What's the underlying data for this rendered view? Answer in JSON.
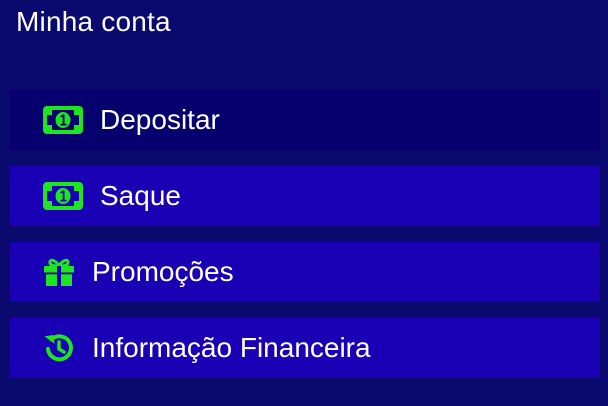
{
  "header": {
    "title": "Minha conta"
  },
  "colors": {
    "background": "#0a0a6e",
    "item_background": "#1a00b4",
    "item_active_background": "#05006e",
    "icon_accent": "#1ee61e",
    "text": "#ffffff"
  },
  "menu": {
    "items": [
      {
        "label": "Depositar",
        "icon": "money-bill-icon",
        "active": true
      },
      {
        "label": "Saque",
        "icon": "money-bill-icon",
        "active": false
      },
      {
        "label": "Promoções",
        "icon": "gift-icon",
        "active": false
      },
      {
        "label": "Informação Financeira",
        "icon": "history-icon",
        "active": false
      }
    ]
  }
}
